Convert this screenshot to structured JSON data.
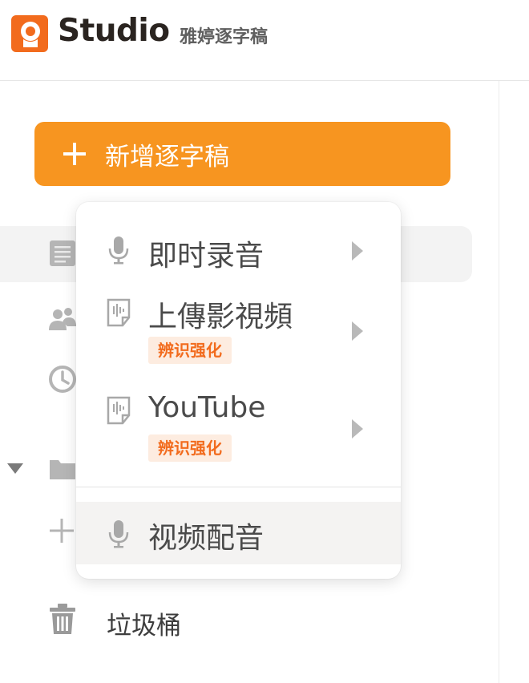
{
  "app": {
    "brand": "Studio",
    "subtitle": "雅婷逐字稿",
    "accent_color": "#f79520"
  },
  "sidebar": {
    "new_button_label": "新增逐字稿",
    "trash_label": "垃圾桶",
    "icons": [
      "document-icon",
      "users-icon",
      "clock-icon",
      "folder-icon",
      "plus-icon",
      "trash-icon"
    ]
  },
  "dropdown": {
    "items": [
      {
        "label": "即时录音",
        "icon": "microphone-icon",
        "badge": ""
      },
      {
        "label": "上傳影視頻",
        "icon": "audio-file-icon",
        "badge": "辨识强化"
      },
      {
        "label": "YouTube",
        "icon": "audio-file-icon",
        "badge": "辨识强化"
      },
      {
        "label": "视频配音",
        "icon": "microphone-icon",
        "badge": ""
      }
    ],
    "badge_color": "#f26b1d"
  }
}
